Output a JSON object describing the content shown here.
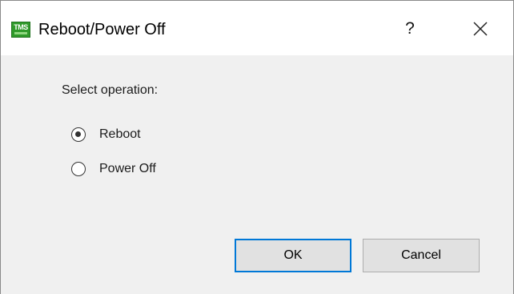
{
  "window": {
    "title": "Reboot/Power Off",
    "app_icon": {
      "name": "tms-app-icon",
      "label": "TMS"
    },
    "help_label": "?",
    "close_icon": "close-icon"
  },
  "form": {
    "prompt": "Select operation:",
    "options": [
      {
        "label": "Reboot",
        "selected": true
      },
      {
        "label": "Power Off",
        "selected": false
      }
    ]
  },
  "buttons": {
    "ok_label": "OK",
    "cancel_label": "Cancel"
  },
  "colors": {
    "titlebar": "#ffffff",
    "content": "#f0f0f0",
    "button_face": "#e1e1e1",
    "button_default_border": "#0078d7",
    "app_icon_green": "#2f9a2a"
  }
}
